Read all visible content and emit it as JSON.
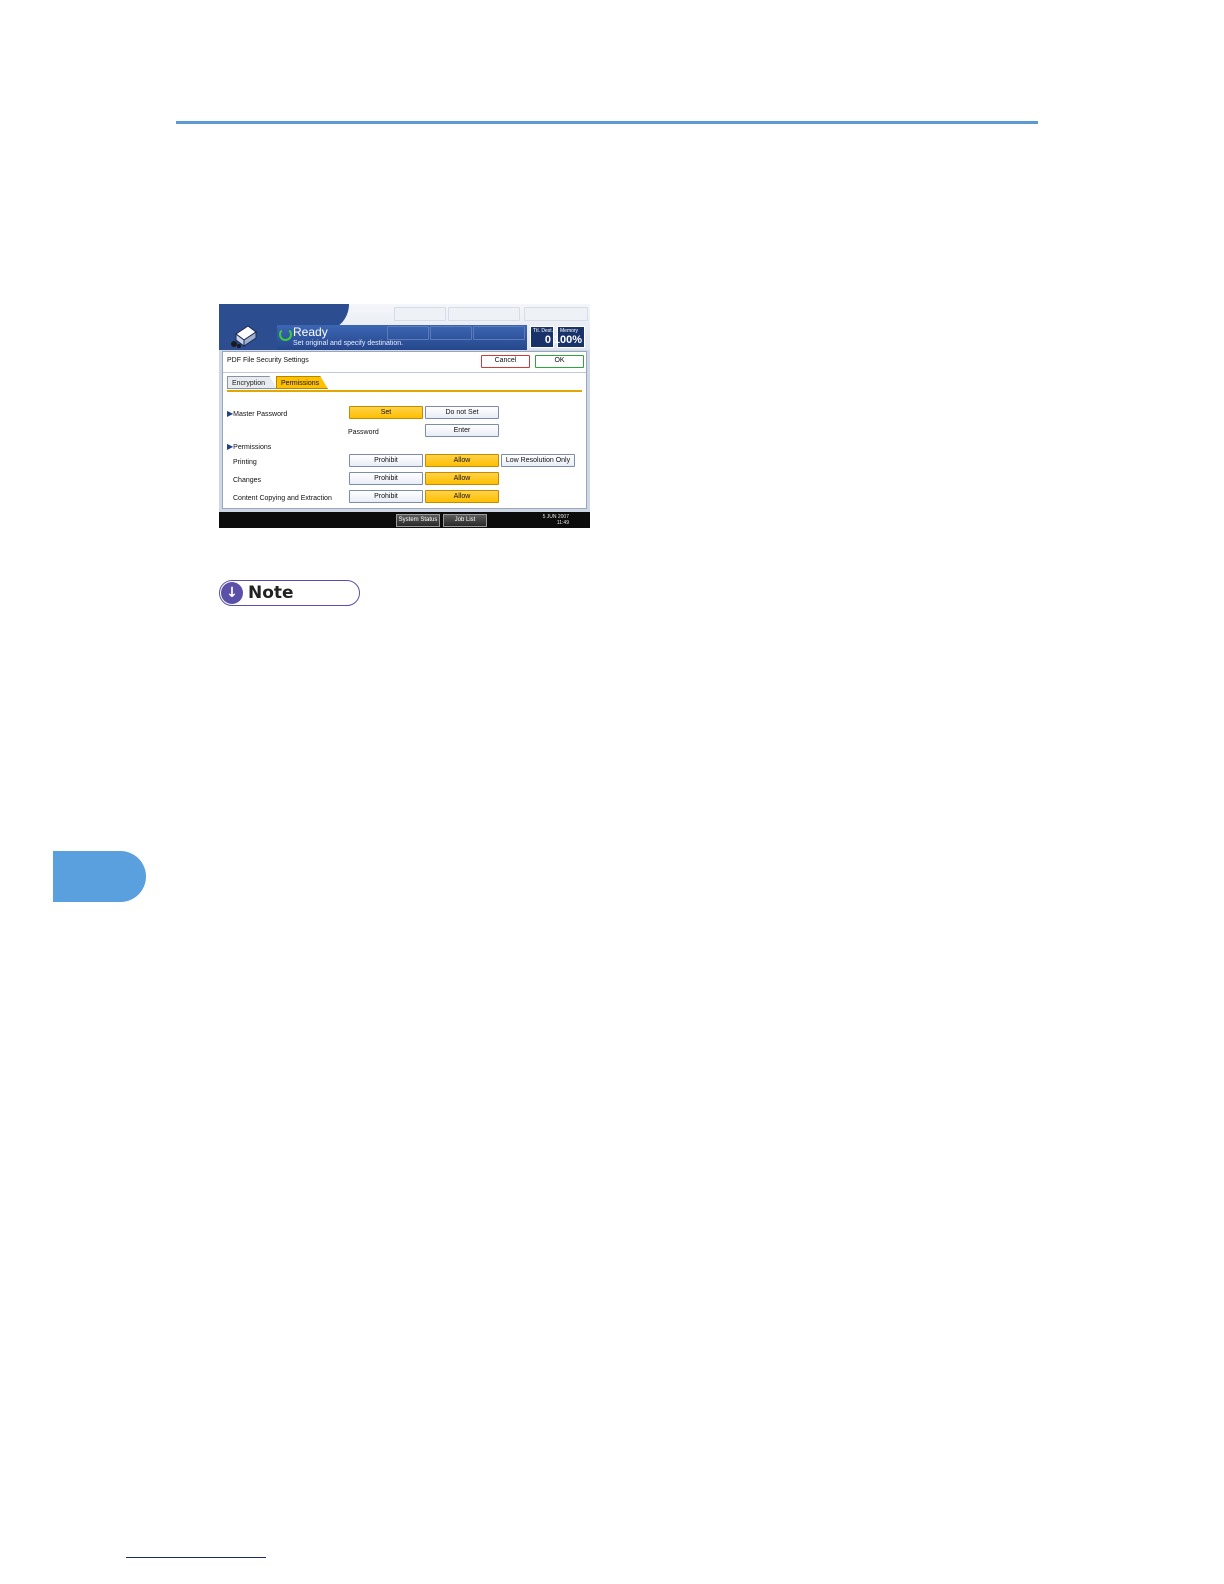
{
  "screen": {
    "status": {
      "title": "Ready",
      "message": "Set original and specify destination."
    },
    "counters": [
      {
        "caption": "Ttl. Dest.",
        "value": "0"
      },
      {
        "caption": "Memory",
        "value": "100%"
      }
    ],
    "dialog": {
      "title": "PDF File Security Settings",
      "cancel_label": "Cancel",
      "ok_label": "OK",
      "tabs": [
        {
          "label": "Encryption",
          "active": false
        },
        {
          "label": "Permissions",
          "active": true
        }
      ],
      "master_password": {
        "section_label": "Master Password",
        "set_label": "Set",
        "do_not_set_label": "Do not Set",
        "selected": "Set",
        "password_label": "Password",
        "enter_label": "Enter"
      },
      "permissions": {
        "section_label": "Permissions",
        "rows": [
          {
            "label": "Printing",
            "prohibit": "Prohibit",
            "allow": "Allow",
            "extra": "Low Resolution Only",
            "selected": "Allow"
          },
          {
            "label": "Changes",
            "prohibit": "Prohibit",
            "allow": "Allow",
            "selected": "Allow"
          },
          {
            "label": "Content Copying and Extraction",
            "prohibit": "Prohibit",
            "allow": "Allow",
            "selected": "Allow"
          }
        ]
      }
    },
    "footer": {
      "system_status_label": "System Status",
      "job_list_label": "Job List",
      "date": "5 JUN  2007",
      "time": "11:49"
    }
  },
  "note": {
    "label": "Note"
  },
  "colors": {
    "accent_rule": "#5a9bd5",
    "selected_option": "#ffc000",
    "note_badge": "#5b50a8"
  }
}
